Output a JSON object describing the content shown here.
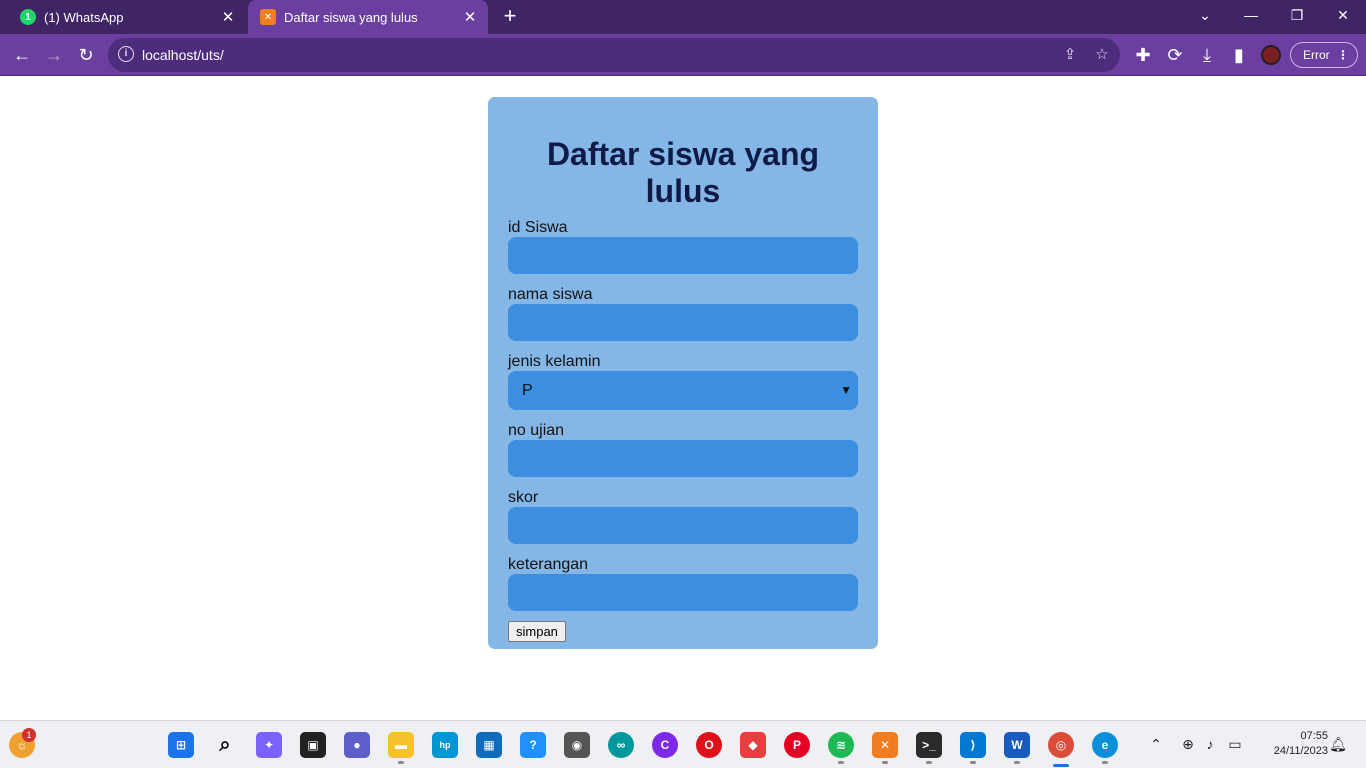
{
  "browser": {
    "tabs": [
      {
        "title": "(1) WhatsApp",
        "favicon": "whatsapp-icon",
        "close": "✕"
      },
      {
        "title": "Daftar siswa yang lulus",
        "favicon": "xampp-icon",
        "close": "✕"
      }
    ],
    "new_tab": "+",
    "address": "localhost/uts/",
    "profile_status": "Error"
  },
  "form": {
    "title": "Daftar siswa yang lulus",
    "fields": {
      "id_siswa": {
        "label": "id Siswa",
        "value": ""
      },
      "nama_siswa": {
        "label": "nama siswa",
        "value": ""
      },
      "jenis_kelamin": {
        "label": "jenis kelamin",
        "selected": "P"
      },
      "no_ujian": {
        "label": "no ujian",
        "value": ""
      },
      "skor": {
        "label": "skor",
        "value": ""
      },
      "keterangan": {
        "label": "keterangan",
        "value": ""
      }
    },
    "submit_label": "simpan"
  },
  "taskbar": {
    "widget_badge": "1",
    "apps": [
      "windows-start-icon",
      "search-icon",
      "copilot-icon",
      "task-view-icon",
      "teams-chat-icon",
      "file-explorer-icon",
      "myhp-icon",
      "store-icon",
      "get-started-icon",
      "camera-icon",
      "arduino-icon",
      "canva-icon",
      "opera-icon",
      "git-icon",
      "pinterest-icon",
      "spotify-icon",
      "xampp-icon",
      "terminal-icon",
      "vscode-icon",
      "word-icon",
      "chrome-icon",
      "edge-icon"
    ],
    "clock": {
      "time": "07:55",
      "date": "24/11/2023"
    }
  },
  "colors": {
    "browser_frame": "#3f2466",
    "toolbar": "#6a3fa0",
    "card_background": "#84b6e6",
    "input_background": "#3b8ee0",
    "title_color": "#0f1a47"
  }
}
